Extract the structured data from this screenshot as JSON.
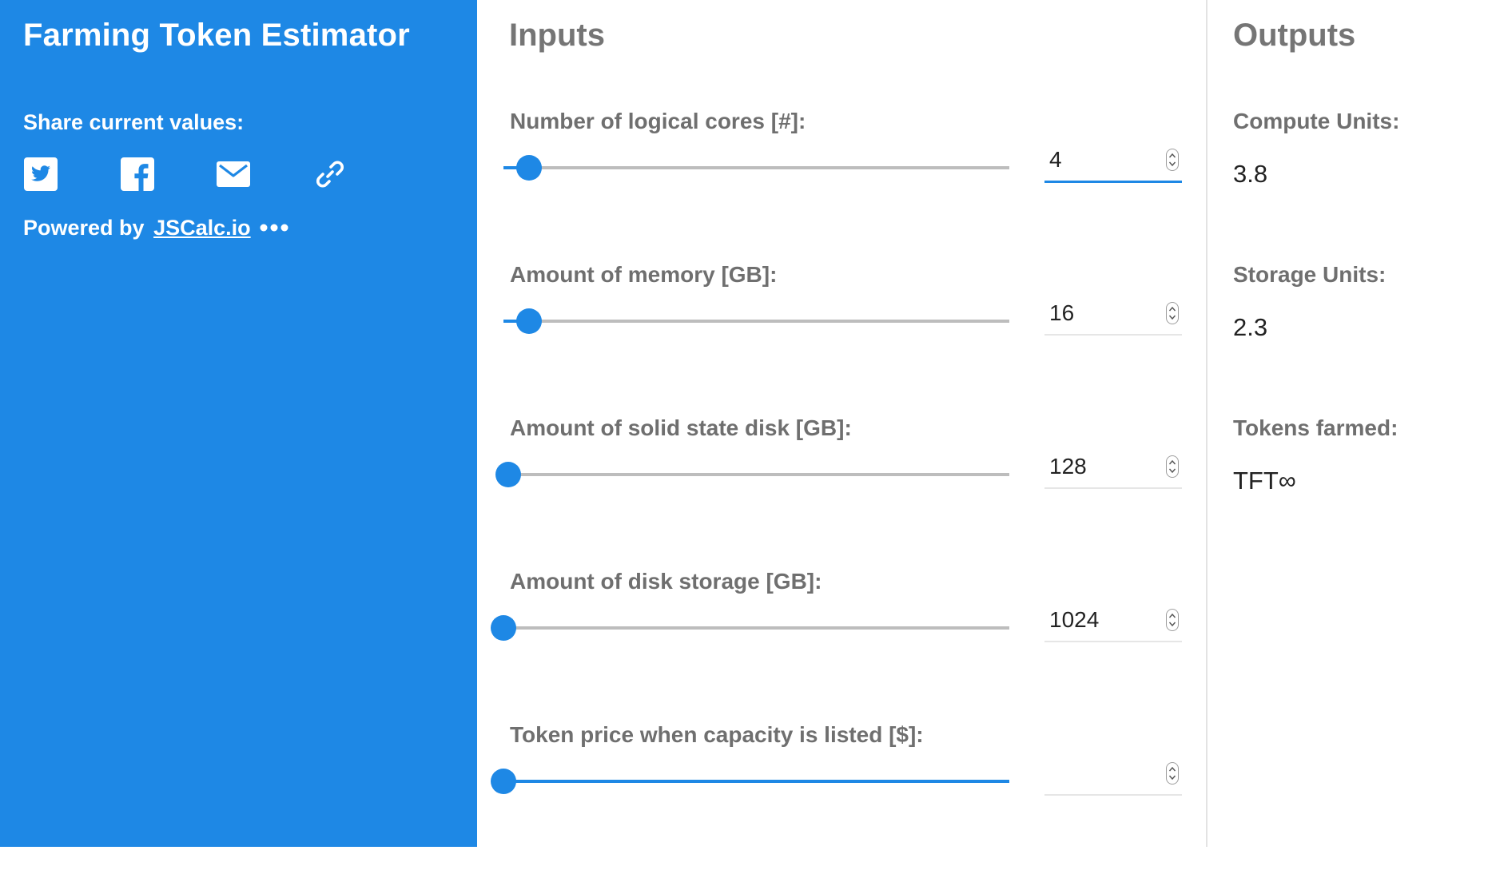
{
  "app": {
    "title": "Farming Token Estimator"
  },
  "sidebar": {
    "share_label": "Share current values:",
    "share_icons": [
      "twitter-icon",
      "facebook-icon",
      "email-icon",
      "link-icon"
    ],
    "powered_by_prefix": "Powered by",
    "powered_by_link": "JSCalc.io",
    "more_icon": "more-dots-icon"
  },
  "inputs": {
    "title": "Inputs",
    "fields": [
      {
        "label": "Number of logical cores [#]:",
        "value": "4",
        "slider_fraction": 0.05,
        "focused": true
      },
      {
        "label": "Amount of memory [GB]:",
        "value": "16",
        "slider_fraction": 0.05,
        "focused": false
      },
      {
        "label": "Amount of solid state disk [GB]:",
        "value": "128",
        "slider_fraction": 0.01,
        "focused": false
      },
      {
        "label": "Amount of disk storage [GB]:",
        "value": "1024",
        "slider_fraction": 0.0,
        "focused": false
      },
      {
        "label": "Token price when capacity is listed [$]:",
        "value": "",
        "slider_fraction": 0.0,
        "focused": false
      }
    ]
  },
  "outputs": {
    "title": "Outputs",
    "items": [
      {
        "label": "Compute Units:",
        "value": "3.8"
      },
      {
        "label": "Storage Units:",
        "value": "2.3"
      },
      {
        "label": "Tokens farmed:",
        "value": "TFT∞"
      }
    ]
  },
  "colors": {
    "accent": "#1e88e5",
    "sidebar_text": "#ffffff",
    "label_gray": "#6f6f6f",
    "track_gray": "#bdbdbd"
  }
}
